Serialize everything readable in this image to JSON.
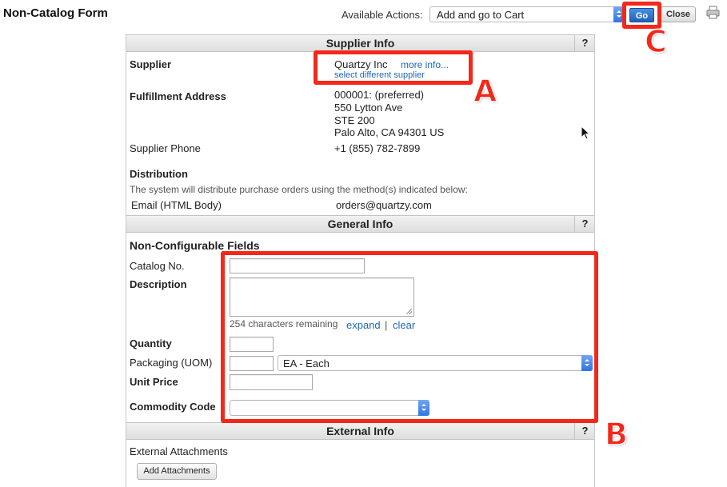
{
  "header": {
    "title": "Non-Catalog Form",
    "actions_label": "Available Actions:",
    "actions_selected": "Add and go to Cart",
    "go_label": "Go",
    "close_label": "Close"
  },
  "supplier_info": {
    "section_title": "Supplier Info",
    "help": "?",
    "supplier_label": "Supplier",
    "supplier_name": "Quartzy Inc",
    "more_info": "more info...",
    "select_different": "select different supplier",
    "fulfillment_label": "Fulfillment Address",
    "address_lines": [
      "000001: (preferred)",
      "550 Lytton Ave",
      "STE 200",
      "Palo Alto, CA 94301 US"
    ],
    "phone_label": "Supplier Phone",
    "phone_value": "+1 (855) 782-7899",
    "distribution_label": "Distribution",
    "distribution_note": "The system will distribute purchase orders using the method(s) indicated below:",
    "email_label": "Email (HTML Body)",
    "email_value": "orders@quartzy.com"
  },
  "general_info": {
    "section_title": "General Info",
    "help": "?",
    "subheading": "Non-Configurable Fields",
    "catalog_no_label": "Catalog No.",
    "catalog_no_value": "",
    "description_label": "Description",
    "description_value": "",
    "chars_remaining": "254 characters remaining",
    "expand": "expand",
    "separator": "|",
    "clear": "clear",
    "quantity_label": "Quantity",
    "quantity_value": "",
    "packaging_label": "Packaging (UOM)",
    "packaging_qty_value": "",
    "packaging_selected": "EA - Each",
    "unit_price_label": "Unit Price",
    "unit_price_value": "",
    "commodity_label": "Commodity Code",
    "commodity_selected": ""
  },
  "external_info": {
    "section_title": "External Info",
    "help": "?",
    "attachments_label": "External Attachments",
    "add_attachments": "Add Attachments"
  },
  "annotations": {
    "a": "A",
    "b": "B",
    "c": "C",
    "color": "#f3281b"
  },
  "colors": {
    "link": "#1e67b8",
    "go_button": "#1f62b8",
    "section_header": "#e6e6e6"
  }
}
